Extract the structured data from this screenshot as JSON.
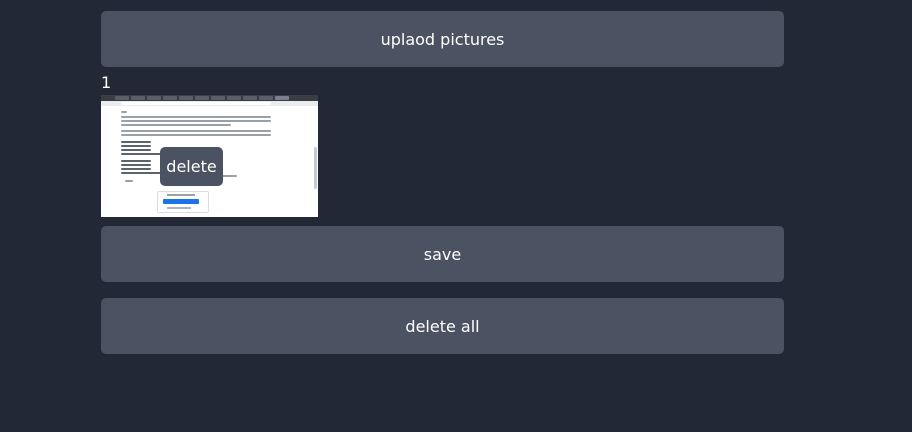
{
  "upload": {
    "label": "uplaod pictures"
  },
  "gallery": {
    "count": "1",
    "items": [
      {
        "delete_label": "delete"
      }
    ]
  },
  "actions": {
    "save_label": "save",
    "delete_all_label": "delete all"
  },
  "colors": {
    "background": "#222836",
    "button": "#4b5262",
    "text": "#ffffff"
  }
}
